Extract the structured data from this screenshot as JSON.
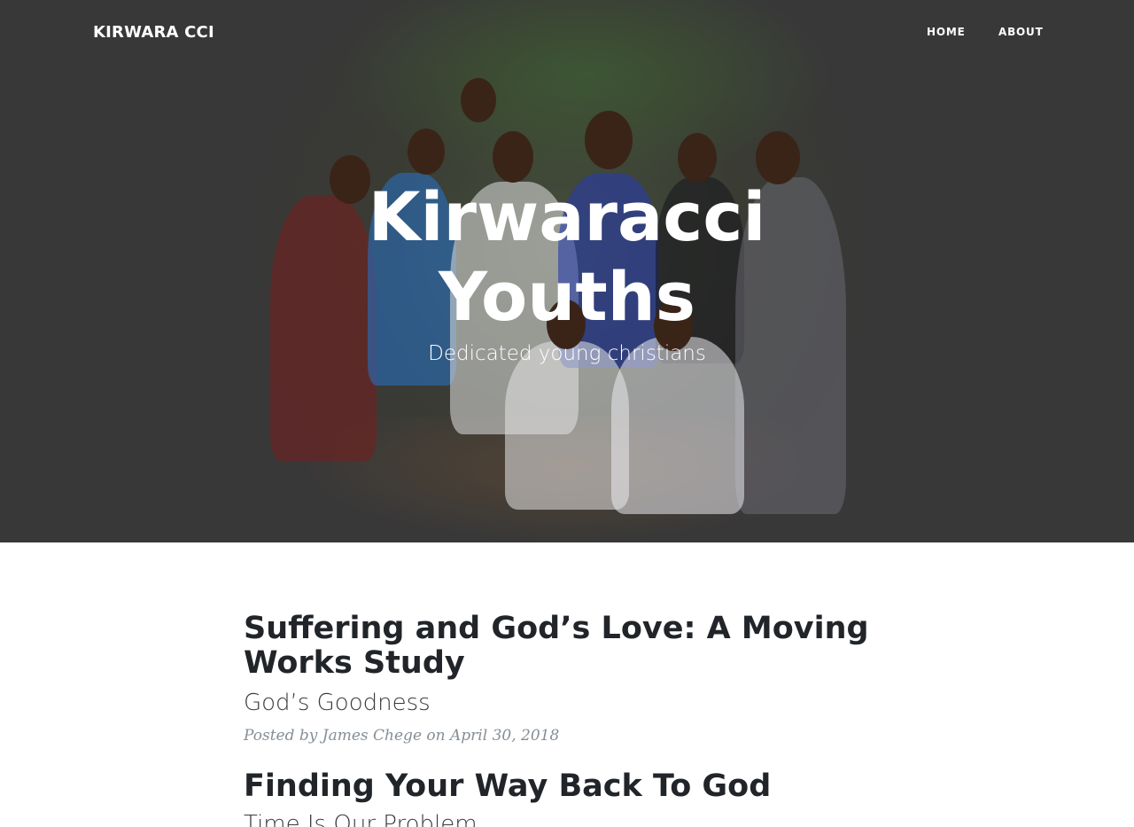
{
  "nav": {
    "brand": "KIRWARA CCI",
    "links": [
      {
        "label": "HOME"
      },
      {
        "label": "ABOUT"
      }
    ]
  },
  "hero": {
    "title": "Kirwaracci Youths",
    "subtitle": "Dedicated young christians"
  },
  "posts": [
    {
      "title": "Suffering and God’s Love: A Moving Works Study",
      "subtitle": "God’s Goodness",
      "meta_prefix": "Posted by",
      "author": "James Chege",
      "meta_on": "on",
      "date": "April 30, 2018"
    },
    {
      "title": "Finding Your Way Back To God",
      "subtitle": "Time Is Our Problem"
    }
  ],
  "colors": {
    "masthead_bg": "#383838",
    "text_dark": "#212529",
    "meta_gray": "#868e96"
  }
}
